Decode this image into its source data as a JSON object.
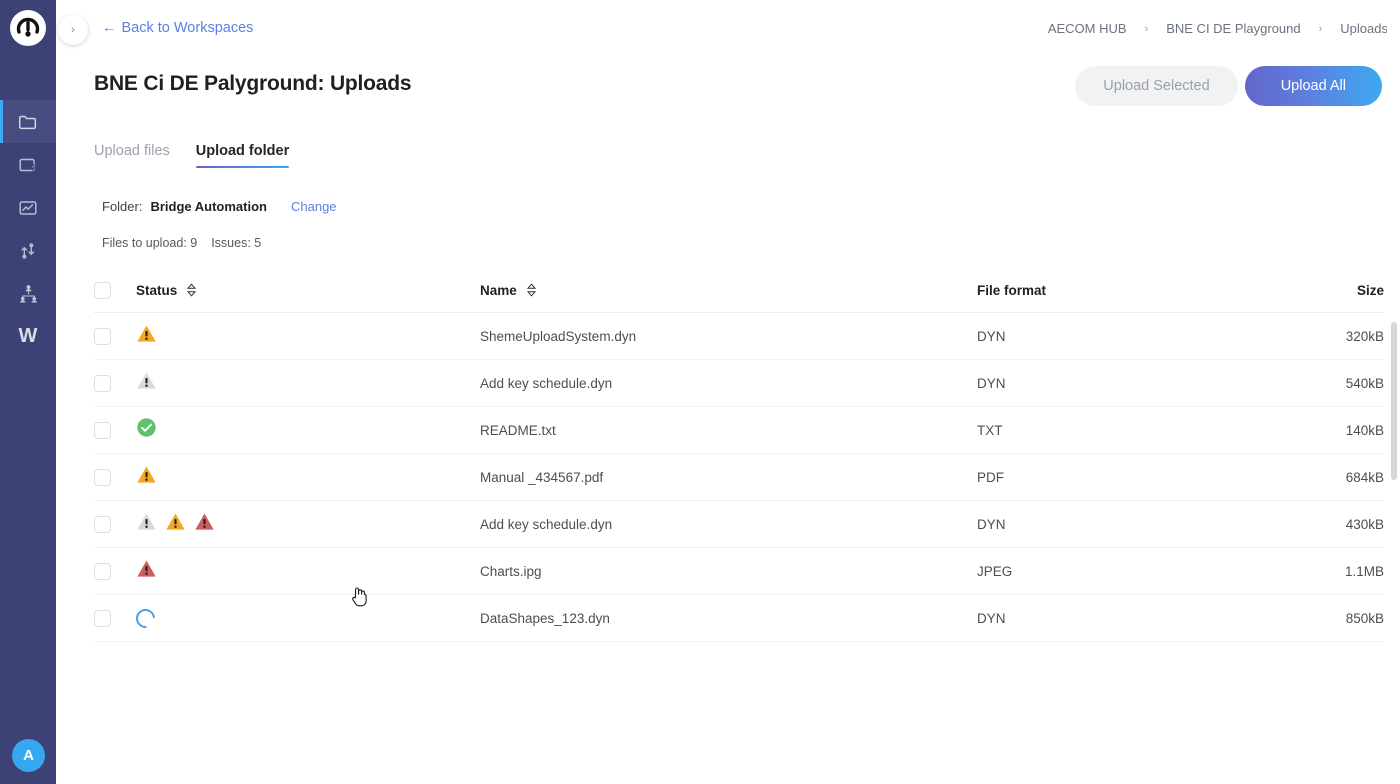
{
  "rail": {
    "logo_name": "app-logo",
    "items": [
      {
        "name": "folder-icon",
        "label": "Files",
        "active": true
      },
      {
        "name": "screen-bolt-icon",
        "label": "Automations",
        "active": false
      },
      {
        "name": "chart-icon",
        "label": "Insights",
        "active": false
      },
      {
        "name": "transfer-icon",
        "label": "Transfers",
        "active": false
      },
      {
        "name": "team-icon",
        "label": "Team",
        "active": false
      },
      {
        "name": "w-logo-icon",
        "label": "W",
        "active": false
      }
    ],
    "avatar_initial": "A",
    "collapse_chevron": "›"
  },
  "header": {
    "back_link": "Back to Workspaces",
    "back_arrow": "←",
    "title": "BNE Ci DE Palyground: Uploads",
    "breadcrumb": [
      {
        "label": "AECOM HUB"
      },
      {
        "label": "BNE CI DE Playground"
      },
      {
        "label": "Uploads"
      }
    ],
    "breadcrumb_separator": "›",
    "upload_selected_label": "Upload Selected",
    "upload_all_label": "Upload All"
  },
  "tabs": [
    {
      "label": "Upload files",
      "active": false
    },
    {
      "label": "Upload folder",
      "active": true
    }
  ],
  "folder": {
    "label": "Folder:",
    "name": "Bridge Automation",
    "change_label": "Change"
  },
  "counts": {
    "files_to_upload": "Files to upload: 9",
    "issues": "Issues: 5"
  },
  "table": {
    "columns": {
      "status": "Status",
      "name": "Name",
      "file_format": "File format",
      "size": "Size"
    },
    "rows": [
      {
        "statuses": [
          "warning-orange"
        ],
        "name": "ShemeUploadSystem.dyn",
        "format": "DYN",
        "size": "320kB"
      },
      {
        "statuses": [
          "warning-grey"
        ],
        "name": "Add key schedule.dyn",
        "format": "DYN",
        "size": "540kB"
      },
      {
        "statuses": [
          "success-green"
        ],
        "name": "README.txt",
        "format": "TXT",
        "size": "140kB"
      },
      {
        "statuses": [
          "warning-orange"
        ],
        "name": "Manual _434567.pdf",
        "format": "PDF",
        "size": "684kB"
      },
      {
        "statuses": [
          "warning-grey",
          "warning-orange",
          "warning-red"
        ],
        "name": "Add key schedule.dyn",
        "format": "DYN",
        "size": "430kB"
      },
      {
        "statuses": [
          "warning-red"
        ],
        "name": "Charts.ipg",
        "format": "JPEG",
        "size": "1.1MB"
      },
      {
        "statuses": [
          "spinner"
        ],
        "name": "DataShapes_123.dyn",
        "format": "DYN",
        "size": "850kB"
      }
    ]
  },
  "colors": {
    "rail_bg": "#3c4276",
    "accent_blue": "#3ea8f0",
    "accent_purple": "#6366c9",
    "link": "#5d7fe4",
    "warning_orange": "#f5a623",
    "warning_grey": "#d8d9dd",
    "warning_red": "#cf5c5c",
    "success_green": "#5ec269"
  }
}
